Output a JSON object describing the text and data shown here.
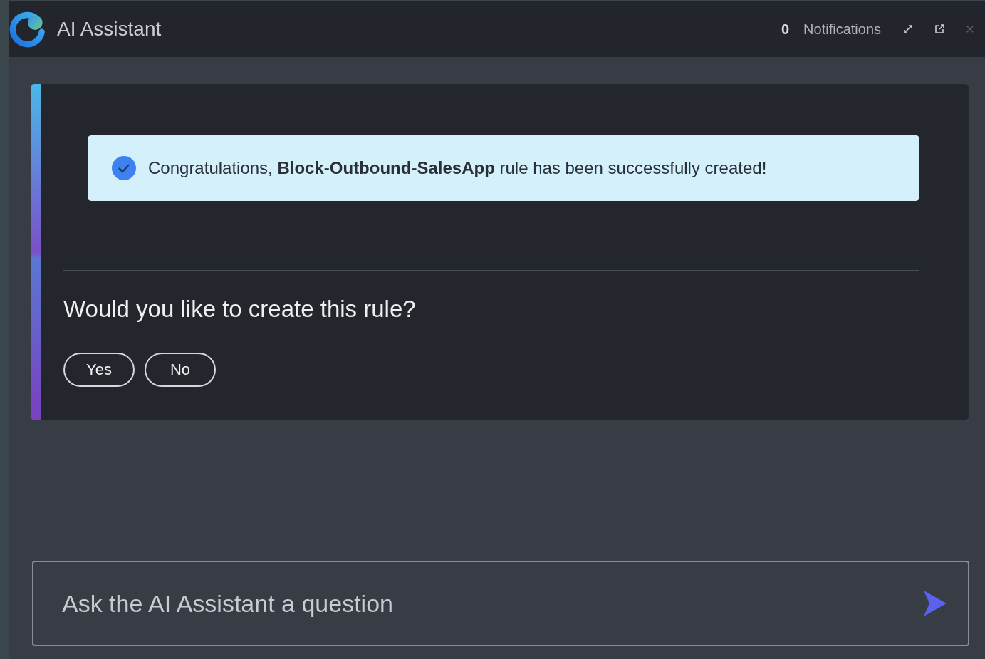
{
  "window": {
    "title": "AI Assistant"
  },
  "header": {
    "notification_count": "0",
    "notifications_label": "Notifications"
  },
  "message": {
    "banner": "Congratulations, **Block-Outbound-SalesApp** rule has been successfully created!",
    "question": "Would you like to create this rule?",
    "options": [
      "Yes",
      "No"
    ]
  },
  "composer": {
    "placeholder": "Ask the AI Assistant a question"
  }
}
